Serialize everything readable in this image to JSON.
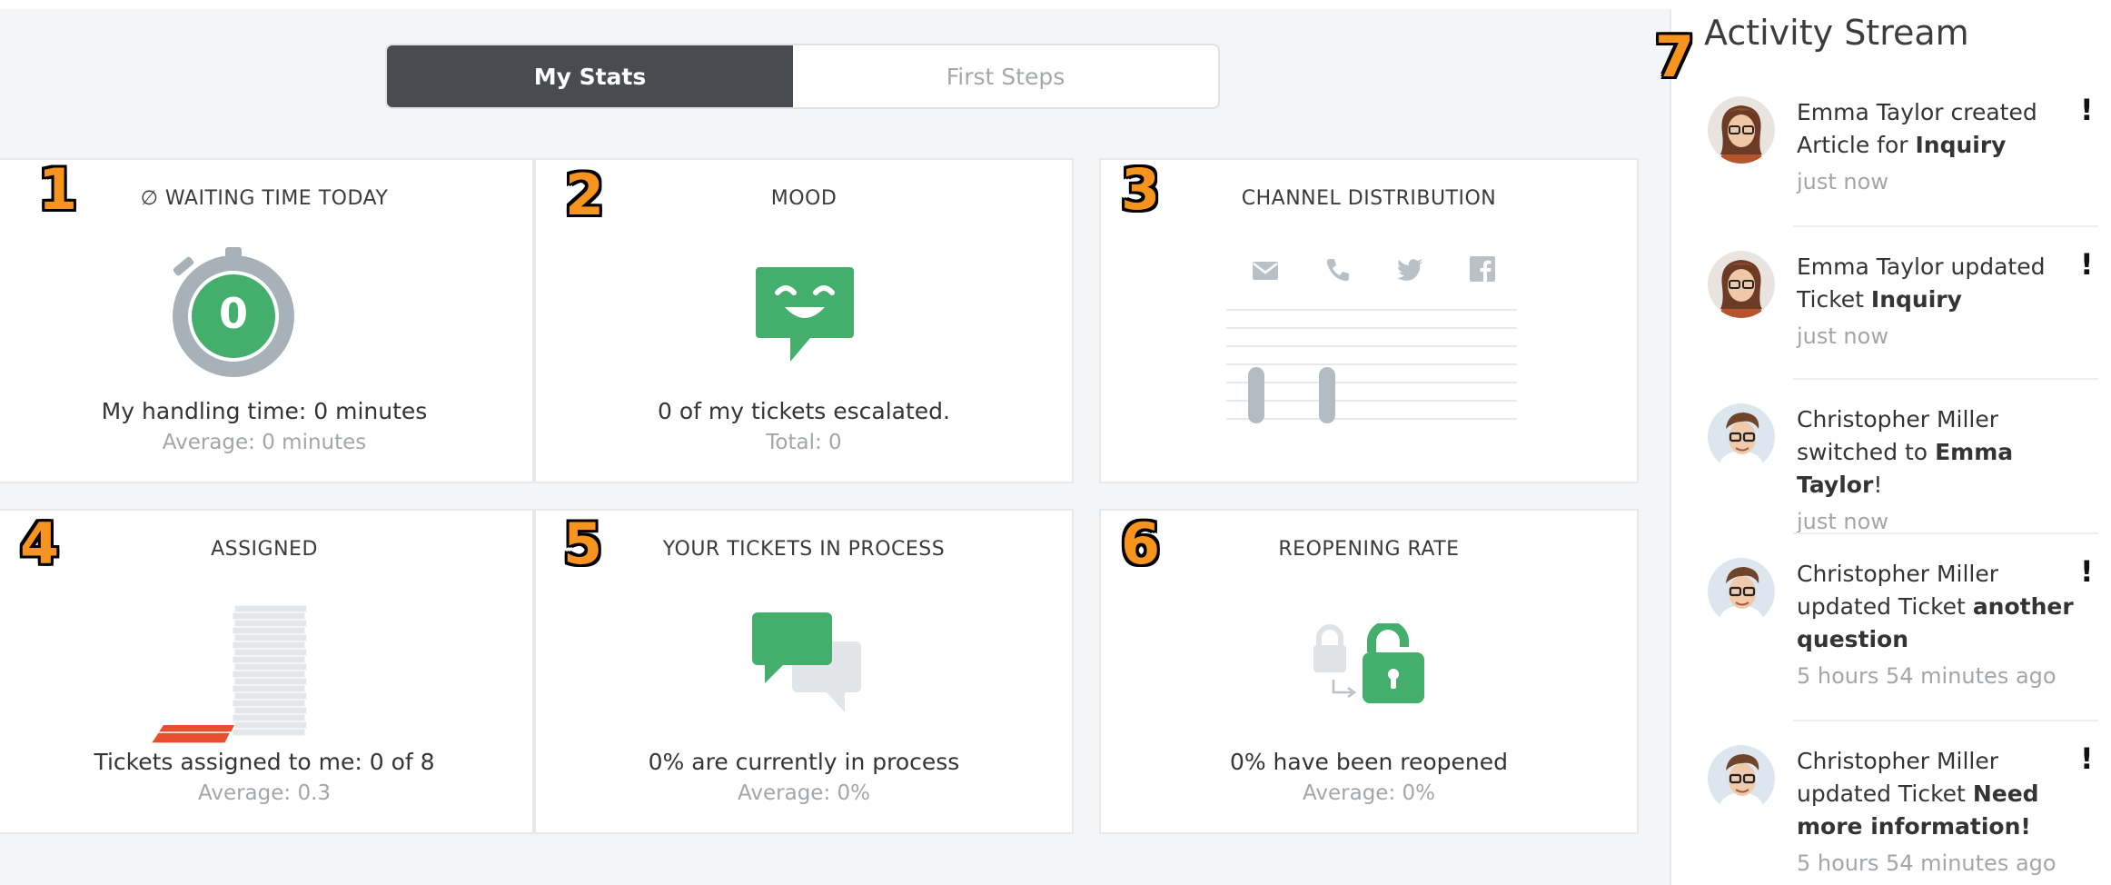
{
  "tabs": [
    {
      "label": "My Stats",
      "active": true
    },
    {
      "label": "First Steps",
      "active": false
    }
  ],
  "cards": [
    {
      "number": "1",
      "title": "∅ WAITING TIME TODAY",
      "main": "My handling time: 0 minutes",
      "sub": "Average: 0 minutes",
      "icon": "stopwatch-icon",
      "value": "0"
    },
    {
      "number": "2",
      "title": "MOOD",
      "main": "0 of my tickets escalated.",
      "sub": "Total: 0",
      "icon": "smiling-chat-bubble-icon"
    },
    {
      "number": "3",
      "title": "CHANNEL DISTRIBUTION",
      "main": "",
      "sub": "",
      "icon": "channel-bar-chart",
      "channels": [
        "email-icon",
        "phone-icon",
        "twitter-icon",
        "facebook-icon"
      ]
    },
    {
      "number": "4",
      "title": "ASSIGNED",
      "main": "Tickets assigned to me: 0 of 8",
      "sub": "Average: 0.3",
      "icon": "ticket-stack-icon"
    },
    {
      "number": "5",
      "title": "YOUR TICKETS IN PROCESS",
      "main": "0% are currently in process",
      "sub": "Average: 0%",
      "icon": "chat-bubbles-icon"
    },
    {
      "number": "6",
      "title": "REOPENING RATE",
      "main": "0% have been reopened",
      "sub": "Average: 0%",
      "icon": "unlocked-padlock-icon"
    }
  ],
  "stream": {
    "number": "7",
    "title": "Activity Stream",
    "items": [
      {
        "avatar": "emma-avatar",
        "line_pre": "Emma Taylor created Article for ",
        "bold": "Inquiry",
        "line_post": "",
        "time": "just now",
        "flag": "!"
      },
      {
        "avatar": "emma-avatar",
        "line_pre": "Emma Taylor updated Ticket ",
        "bold": "Inquiry",
        "line_post": "",
        "time": "just now",
        "flag": "!"
      },
      {
        "avatar": "christopher-avatar",
        "line_pre": "Christopher Miller switched to ",
        "bold": "Emma Taylor",
        "line_post": "!",
        "time": "just now",
        "flag": ""
      },
      {
        "avatar": "christopher-avatar",
        "line_pre": "Christopher Miller updated Ticket ",
        "bold": "another question",
        "line_post": "",
        "time": "5 hours 54 minutes ago",
        "flag": "!"
      },
      {
        "avatar": "christopher-avatar",
        "line_pre": "Christopher Miller updated Ticket ",
        "bold": "Need more information!",
        "line_post": "",
        "time": "5 hours 54 minutes ago",
        "flag": "!"
      }
    ]
  },
  "colors": {
    "green": "#44ae6c",
    "dark_tab": "#484b50",
    "badge": "#f7941d",
    "grey_icon": "#b9c1c7",
    "red_ticket": "#e84e2c"
  }
}
